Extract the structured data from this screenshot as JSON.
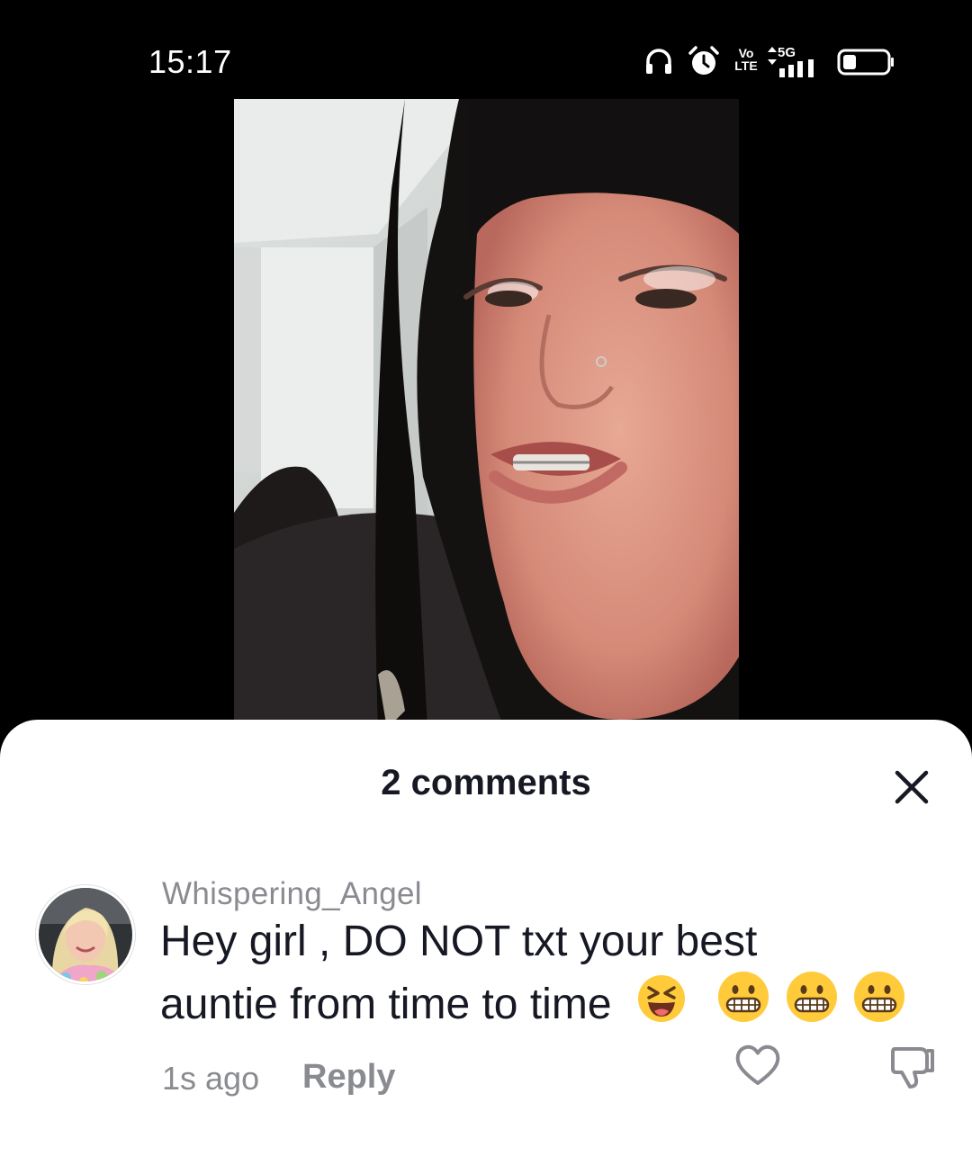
{
  "status_bar": {
    "time": "15:17",
    "icons": [
      "headphones-icon",
      "alarm-icon",
      "volte-icon",
      "5g-signal-icon",
      "battery-icon"
    ],
    "volte_top": "Vo",
    "volte_bottom": "LTE",
    "network": "5G"
  },
  "video": {
    "description_icon": "video-frame"
  },
  "comments_sheet": {
    "title": "2 comments",
    "close_icon": "close-icon",
    "comments": [
      {
        "username": "Whispering_Angel",
        "text_line1": "Hey girl , DO NOT txt your best",
        "text_line2": "auntie from time to time",
        "emojis": [
          "laughing-squint-emoji",
          "grimacing-emoji",
          "grimacing-emoji",
          "grimacing-emoji"
        ],
        "time": "1s ago",
        "reply_label": "Reply"
      }
    ]
  },
  "colors": {
    "text_primary": "#161823",
    "text_secondary": "#8a8b91",
    "sheet_bg": "#ffffff",
    "background": "#000000"
  }
}
